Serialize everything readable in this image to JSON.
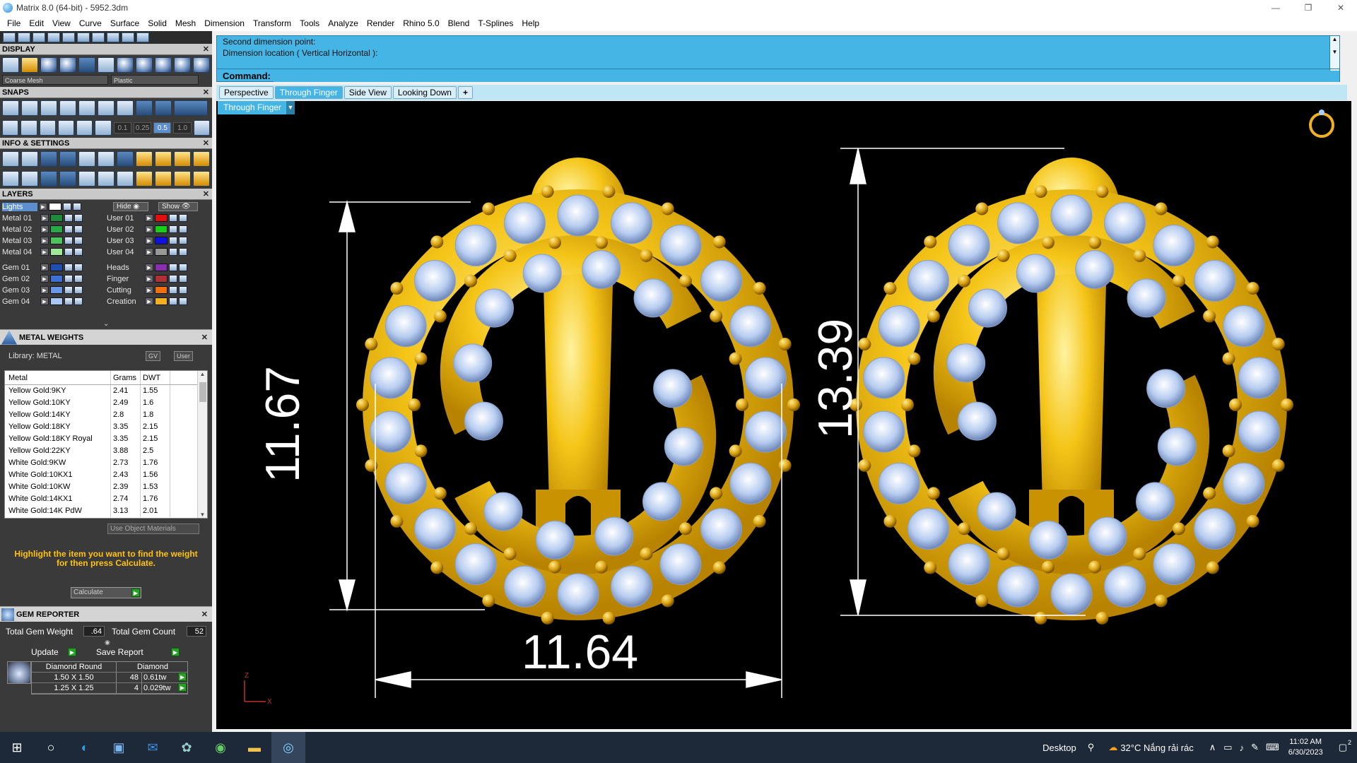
{
  "window": {
    "title": "Matrix 8.0 (64-bit) - 5952.3dm"
  },
  "menu": [
    "File",
    "Edit",
    "View",
    "Curve",
    "Surface",
    "Solid",
    "Mesh",
    "Dimension",
    "Transform",
    "Tools",
    "Analyze",
    "Render",
    "Rhino 5.0",
    "Blend",
    "T-Splines",
    "Help"
  ],
  "display": {
    "title": "DISPLAY",
    "mesh": "Coarse Mesh",
    "material": "Plastic"
  },
  "snaps": {
    "title": "SNAPS",
    "values": [
      "0.1",
      "0.25",
      "0.5",
      "1.0"
    ]
  },
  "info": {
    "title": "INFO & SETTINGS"
  },
  "layers": {
    "title": "LAYERS",
    "lights_label": "Lights",
    "hide_label": "Hide",
    "show_label": "Show",
    "left": [
      {
        "name": "Metal 01",
        "color": "#1f8a3c"
      },
      {
        "name": "Metal 02",
        "color": "#29a84a"
      },
      {
        "name": "Metal 03",
        "color": "#4cc35e"
      },
      {
        "name": "Metal 04",
        "color": "#9ee89a"
      },
      {
        "name": "Gem 01",
        "color": "#1d4fb0"
      },
      {
        "name": "Gem 02",
        "color": "#3d72d4"
      },
      {
        "name": "Gem 03",
        "color": "#6a98e6"
      },
      {
        "name": "Gem 04",
        "color": "#a7c6f2"
      }
    ],
    "right": [
      {
        "name": "User 01",
        "color": "#e01010"
      },
      {
        "name": "User 02",
        "color": "#18d018"
      },
      {
        "name": "User 03",
        "color": "#1010e0"
      },
      {
        "name": "User 04",
        "color": "#999999"
      },
      {
        "name": "Heads",
        "color": "#8a2fb0"
      },
      {
        "name": "Finger",
        "color": "#b03038"
      },
      {
        "name": "Cutting",
        "color": "#f07010"
      },
      {
        "name": "Creation",
        "color": "#f0b020"
      }
    ]
  },
  "metal_weights": {
    "title": "METAL WEIGHTS",
    "library": "Library: METAL",
    "gv": "GV",
    "user": "User",
    "columns": [
      "Metal",
      "Grams",
      "DWT"
    ],
    "rows": [
      [
        "Yellow Gold:9KY",
        "2.41",
        "1.55"
      ],
      [
        "Yellow Gold:10KY",
        "2.49",
        "1.6"
      ],
      [
        "Yellow Gold:14KY",
        "2.8",
        "1.8"
      ],
      [
        "Yellow Gold:18KY",
        "3.35",
        "2.15"
      ],
      [
        "Yellow Gold:18KY Royal",
        "3.35",
        "2.15"
      ],
      [
        "Yellow Gold:22KY",
        "3.88",
        "2.5"
      ],
      [
        "White Gold:9KW",
        "2.73",
        "1.76"
      ],
      [
        "White Gold:10KX1",
        "2.43",
        "1.56"
      ],
      [
        "White Gold:10KW",
        "2.39",
        "1.53"
      ],
      [
        "White Gold:14KX1",
        "2.74",
        "1.76"
      ],
      [
        "White Gold:14K PdW",
        "3.13",
        "2.01"
      ]
    ],
    "use_object": "Use Object Materials",
    "hint": "Highlight the item you want to find the weight for then press Calculate.",
    "calculate": "Calculate"
  },
  "gem_reporter": {
    "title": "GEM REPORTER",
    "weight_label": "Total Gem Weight",
    "weight_value": ".64",
    "count_label": "Total Gem Count",
    "count_value": "52",
    "update": "Update",
    "save": "Save Report",
    "table_head": [
      "Diamond Round",
      "Diamond"
    ],
    "rows": [
      [
        "1.50 X 1.50",
        "48",
        "0.61tw"
      ],
      [
        "1.25 X 1.25",
        "4",
        "0.029tw"
      ]
    ]
  },
  "command": {
    "line1": "Second dimension point:",
    "line2": "Dimension location ( Vertical  Horizontal ):",
    "label": "Command:"
  },
  "tabs": [
    "Perspective",
    "Through Finger",
    "Side View",
    "Looking Down",
    "+"
  ],
  "viewport": {
    "view_name": "Through Finger",
    "dims": {
      "left_height": "11.67",
      "width": "11.64",
      "right_height": "13.39"
    },
    "axis": {
      "z": "Z",
      "x": "X"
    }
  },
  "taskbar": {
    "desktop": "Desktop",
    "weather": "32°C  Nắng rải rác",
    "time": "11:02 AM",
    "date": "6/30/2023",
    "notifications": "2"
  }
}
